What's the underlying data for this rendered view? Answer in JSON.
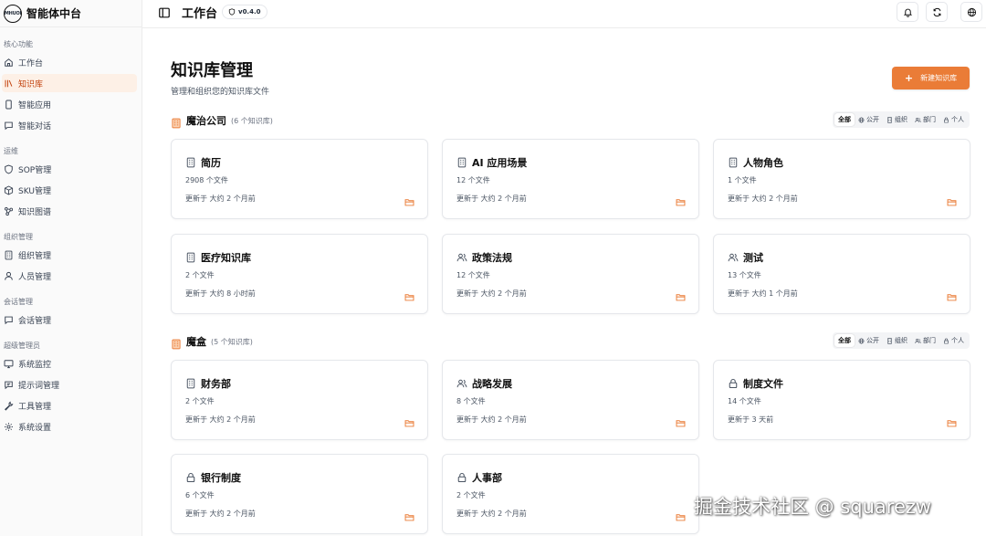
{
  "brand": {
    "logo_text": "MHUOI",
    "name": "智能体中台"
  },
  "sidebar": {
    "sections": [
      {
        "title": "核心功能",
        "items": [
          {
            "label": "工作台",
            "icon": "home-icon"
          },
          {
            "label": "知识库",
            "icon": "library-icon",
            "active": true
          },
          {
            "label": "智能应用",
            "icon": "phone-icon"
          },
          {
            "label": "智能对话",
            "icon": "chat-icon"
          }
        ]
      },
      {
        "title": "运维",
        "items": [
          {
            "label": "SOP管理",
            "icon": "shield-icon"
          },
          {
            "label": "SKU管理",
            "icon": "box-icon"
          },
          {
            "label": "知识图谱",
            "icon": "graph-icon"
          }
        ]
      },
      {
        "title": "组织管理",
        "items": [
          {
            "label": "组织管理",
            "icon": "building-icon"
          },
          {
            "label": "人员管理",
            "icon": "user-icon"
          }
        ]
      },
      {
        "title": "会话管理",
        "items": [
          {
            "label": "会话管理",
            "icon": "chat-icon"
          }
        ]
      },
      {
        "title": "超级管理员",
        "items": [
          {
            "label": "系统监控",
            "icon": "monitor-icon"
          },
          {
            "label": "提示词管理",
            "icon": "prompt-icon"
          },
          {
            "label": "工具管理",
            "icon": "wrench-icon"
          },
          {
            "label": "系统设置",
            "icon": "gear-icon"
          }
        ]
      }
    ]
  },
  "header": {
    "title": "工作台",
    "version": "v0.4.0"
  },
  "page": {
    "title": "知识库管理",
    "subtitle": "管理和组织您的知识库文件",
    "new_button": "新建知识库"
  },
  "filters": [
    "全部",
    "公开",
    "组织",
    "部门",
    "个人"
  ],
  "groups": [
    {
      "name": "魔治公司",
      "count": "(6 个知识库)",
      "cards": [
        {
          "title": "简历",
          "icon": "building-icon",
          "files": "2908 个文件",
          "updated": "更新于 大约 2 个月前"
        },
        {
          "title": "AI 应用场景",
          "icon": "building-icon",
          "files": "12 个文件",
          "updated": "更新于 大约 2 个月前"
        },
        {
          "title": "人物角色",
          "icon": "building-icon",
          "files": "1 个文件",
          "updated": "更新于 大约 2 个月前"
        },
        {
          "title": "医疗知识库",
          "icon": "building-icon",
          "files": "2 个文件",
          "updated": "更新于 大约 8 小时前"
        },
        {
          "title": "政策法规",
          "icon": "users-icon",
          "files": "12 个文件",
          "updated": "更新于 大约 2 个月前"
        },
        {
          "title": "测试",
          "icon": "users-icon",
          "files": "13 个文件",
          "updated": "更新于 大约 1 个月前"
        }
      ]
    },
    {
      "name": "魔盒",
      "count": "(5 个知识库)",
      "cards": [
        {
          "title": "财务部",
          "icon": "building-icon",
          "files": "2 个文件",
          "updated": "更新于 大约 2 个月前"
        },
        {
          "title": "战略发展",
          "icon": "users-icon",
          "files": "8 个文件",
          "updated": "更新于 大约 2 个月前"
        },
        {
          "title": "制度文件",
          "icon": "lock-icon",
          "files": "14 个文件",
          "updated": "更新于 3 天前"
        },
        {
          "title": "银行制度",
          "icon": "lock-icon",
          "files": "6 个文件",
          "updated": "更新于 大约 2 个月前"
        },
        {
          "title": "人事部",
          "icon": "lock-icon",
          "files": "2 个文件",
          "updated": "更新于 大约 2 个月前"
        }
      ]
    }
  ],
  "watermark": "掘金技术社区 @ squarezw",
  "colors": {
    "accent": "#ea7c37",
    "active_bg": "#fdf0e6",
    "active_text": "#c2410c"
  }
}
